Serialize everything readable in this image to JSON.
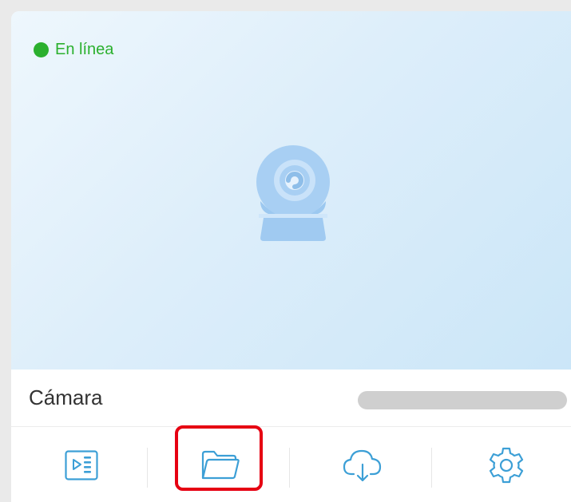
{
  "status": {
    "label": "En línea",
    "color": "#2bb02e"
  },
  "device": {
    "name": "Cámara"
  },
  "actions": [
    {
      "name": "playback",
      "icon": "video-list-icon"
    },
    {
      "name": "files",
      "icon": "folder-icon",
      "highlighted": true
    },
    {
      "name": "cloud",
      "icon": "cloud-download-icon"
    },
    {
      "name": "settings",
      "icon": "gear-icon"
    }
  ],
  "colors": {
    "icon": "#3c9fd6",
    "highlight": "#e60012",
    "online": "#2bb02e"
  }
}
